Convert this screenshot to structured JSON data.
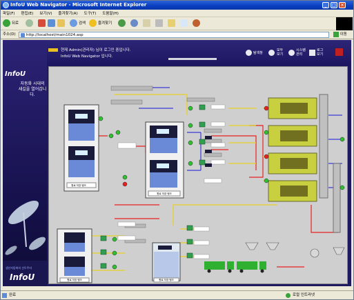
{
  "window": {
    "title": "InfoU Web Navigator - Microsoft Internet Explorer"
  },
  "menu": [
    "파일(F)",
    "편집(E)",
    "보기(V)",
    "즐겨찾기(A)",
    "도구(T)",
    "도움말(H)"
  ],
  "toolbar": {
    "back": "뒤로",
    "search": "검색",
    "favorites": "즐겨찾기"
  },
  "address": {
    "label": "주소(D)",
    "url": "http://localhost/main1024.asp",
    "go": "이동"
  },
  "app": {
    "greeting": "현재 Admin(관리자) 님이 로그인 중입니다.",
    "welcome": "InfoU Web Navigator 입니다.",
    "brand": "InfoU",
    "slogan_1": "자동화 시대의",
    "slogan_2": "새길을 열어갑니다.",
    "bottom_caption": "생산자동화의 선두주자",
    "nav": [
      "탐색창",
      "모두 보기",
      "시스템 관리",
      "로그 보기"
    ]
  },
  "tanks": {
    "t1": "원료 저장 탱크",
    "t2": "원료 저장 탱크",
    "t3": "원료 저장 탱크",
    "t4": "원료 저장 탱크"
  },
  "status": {
    "left": "완료",
    "right": "로컬 인트라넷"
  }
}
